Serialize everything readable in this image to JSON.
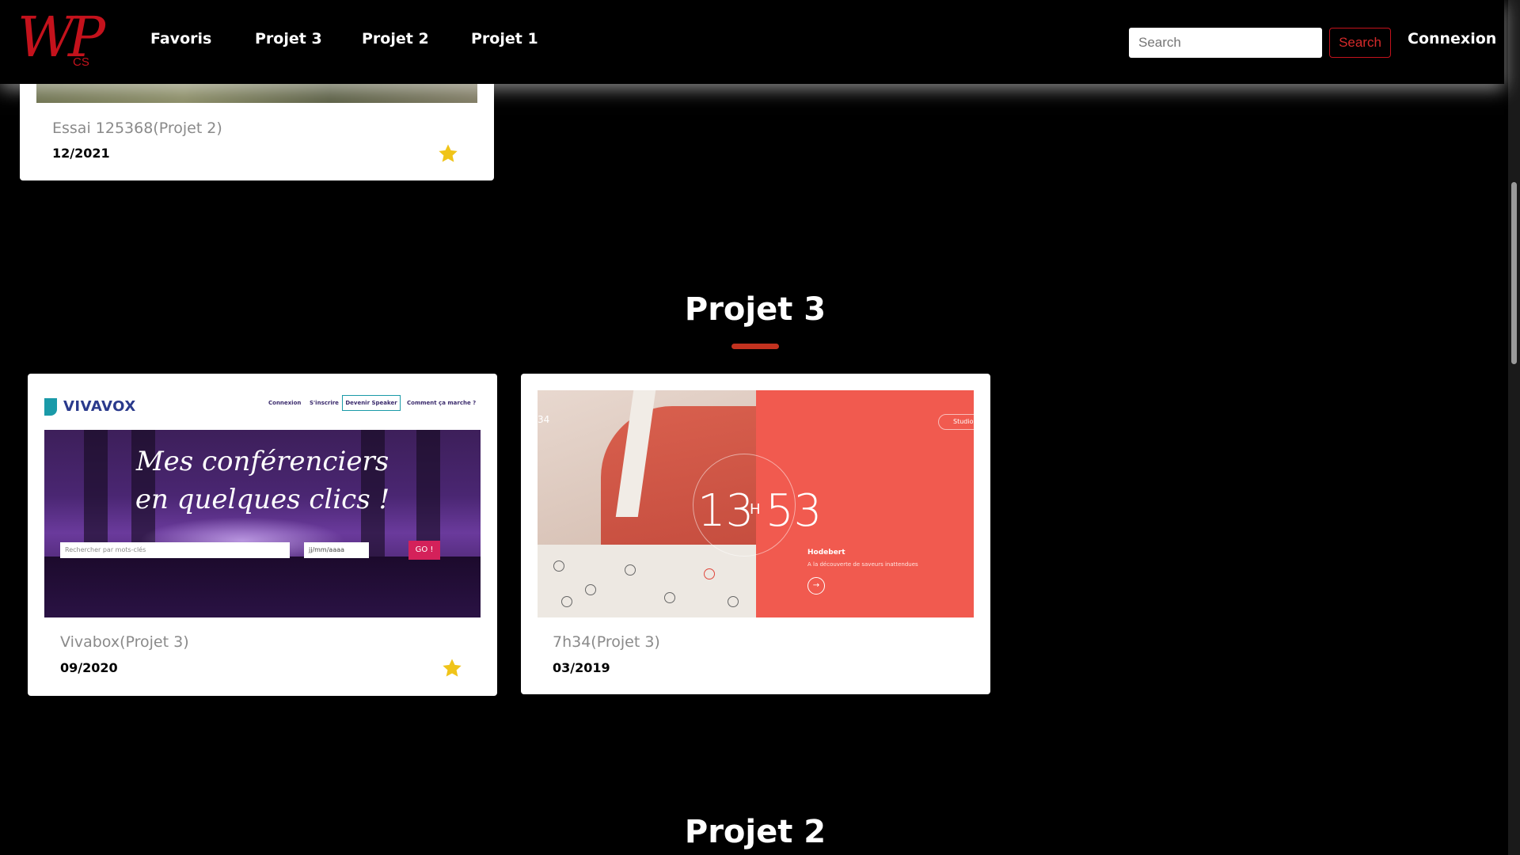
{
  "navbar": {
    "logo_main": "WP",
    "logo_sub": "CS",
    "links": [
      "Favoris",
      "Projet 3",
      "Projet 2",
      "Projet 1"
    ],
    "search_placeholder": "Search",
    "search_button": "Search",
    "connexion": "Connexion"
  },
  "top_card": {
    "title": "Essai 125368(Projet 2)",
    "date": "12/2021",
    "favorite": true
  },
  "sections": [
    {
      "title": "Projet 3",
      "cards": [
        {
          "title": "Vivabox(Projet 3)",
          "date": "09/2020",
          "favorite": true,
          "thumbnail": {
            "logo": "VIVAVOX",
            "nav": [
              "Connexion",
              "S'inscrire",
              "Devenir Speaker",
              "Comment ça marche ?"
            ],
            "headline_1": "Mes conférenciers",
            "headline_2": "en quelques clics !",
            "search_placeholder": "Rechercher par mots-clés",
            "date_placeholder": "jj/mm/aaaa",
            "go": "GO !"
          }
        },
        {
          "title": "7h34(Projet 3)",
          "date": "03/2019",
          "favorite": false,
          "thumbnail": {
            "num": "34",
            "studio": "Studio",
            "hour": "13",
            "h": "H",
            "minute": "53",
            "name": "Hodebert",
            "subtitle": "A la découverte de saveurs inattendues",
            "arrow": "→"
          }
        }
      ]
    },
    {
      "title": "Projet 2"
    }
  ],
  "colors": {
    "accent": "#c4121c",
    "underline": "#c2321f",
    "star": "#f0c419"
  }
}
